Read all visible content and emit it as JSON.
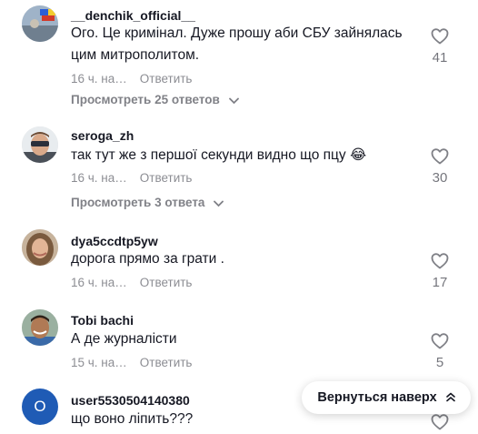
{
  "comments": [
    {
      "username": "__denchik_official__",
      "text": "Ого. Це кримінал. Дуже прошу аби СБУ зайнялась цим митрополитом.",
      "time": "16 ч. на…",
      "reply_label": "Ответить",
      "likes": "41",
      "view_replies": "Просмотреть 25 ответов"
    },
    {
      "username": "seroga_zh",
      "text": "так тут же з першої секунди видно що пцу 😂",
      "time": "16 ч. на…",
      "reply_label": "Ответить",
      "likes": "30",
      "view_replies": "Просмотреть 3 ответа"
    },
    {
      "username": "dya5ccdtp5yw",
      "text": "дорога прямо за грати .",
      "time": "16 ч. на…",
      "reply_label": "Ответить",
      "likes": "17"
    },
    {
      "username": "Tobi bachi",
      "text": "А де журналісти",
      "time": "15 ч. на…",
      "reply_label": "Ответить",
      "likes": "5"
    },
    {
      "username": "user5530504140380",
      "text": "що воно ліпить???",
      "avatar_letter": "O",
      "avatar_color": "#1f5bb5"
    }
  ],
  "scroll_top_label": "Вернуться наверх",
  "icons": {
    "like": "heart-outline-icon",
    "expand": "chevron-down-icon",
    "scroll_top": "double-chevron-up-icon"
  }
}
